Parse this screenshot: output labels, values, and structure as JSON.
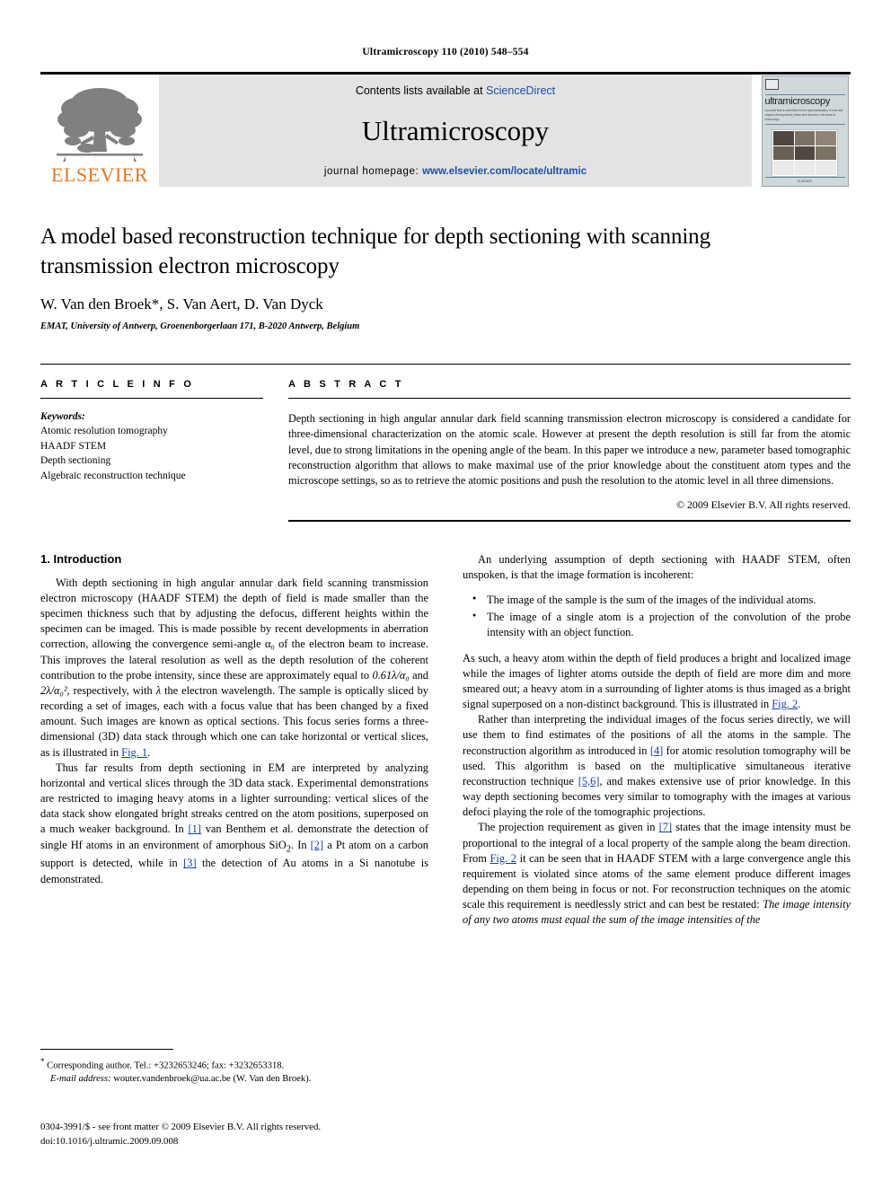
{
  "running_head": "Ultramicroscopy 110 (2010) 548–554",
  "masthead": {
    "publisher_name": "ELSEVIER",
    "contents_prefix": "Contents lists available at",
    "contents_link": "ScienceDirect",
    "journal_title": "Ultramicroscopy",
    "homepage_prefix": "journal homepage:",
    "homepage_link": "www.elsevier.com/locate/ultramic",
    "cover": {
      "name": "ultramicroscopy",
      "tagline": "A journal that is committed to the rapid publication of new and original developments, ideas and theories in all areas of microscopy",
      "footer": "ELSEVIER"
    },
    "link_color": "#1a4fa0",
    "brand_color": "#E87722"
  },
  "article": {
    "title": "A model based reconstruction technique for depth sectioning with scanning transmission electron microscopy",
    "authors": "W. Van den Broek*, S. Van Aert, D. Van Dyck",
    "affiliation": "EMAT, University of Antwerp, Groenenborgerlaan 171, B-2020 Antwerp, Belgium"
  },
  "article_info": {
    "label": "A R T I C L E   I N F O",
    "keywords_label": "Keywords:",
    "keywords": [
      "Atomic resolution tomography",
      "HAADF STEM",
      "Depth sectioning",
      "Algebraic reconstruction technique"
    ]
  },
  "abstract": {
    "label": "A B S T R A C T",
    "text": "Depth sectioning in high angular annular dark field scanning transmission electron microscopy is considered a candidate for three-dimensional characterization on the atomic scale. However at present the depth resolution is still far from the atomic level, due to strong limitations in the opening angle of the beam. In this paper we introduce a new, parameter based tomographic reconstruction algorithm that allows to make maximal use of the prior knowledge about the constituent atom types and the microscope settings, so as to retrieve the atomic positions and push the resolution to the atomic level in all three dimensions.",
    "copyright": "© 2009 Elsevier B.V. All rights reserved."
  },
  "body": {
    "section1_heading": "1.  Introduction",
    "left": {
      "p1_a": "With depth sectioning in high angular annular dark field scanning transmission electron microscopy (HAADF STEM) the depth of field is made smaller than the specimen thickness such that by adjusting the defocus, different heights within the specimen can be imaged. This is made possible by recent developments in aberration correction, allowing the convergence semi-angle ",
      "p1_alpha0": "α₀",
      "p1_b": " of the electron beam to increase. This improves the lateral resolution as well as the depth resolution of the coherent contribution to the probe intensity, since these are approximately equal to ",
      "p1_expr1": "0.61λ/α₀",
      "p1_c": " and ",
      "p1_expr2": "2λ/α₀²",
      "p1_d": ", respectively, with ",
      "p1_lambda": "λ",
      "p1_e": " the electron wavelength. The sample is optically sliced by recording a set of images, each with a focus value that has been changed by a fixed amount. Such images are known as optical sections. This focus series forms a three-dimensional (3D) data stack through which one can take horizontal or vertical slices, as is illustrated in ",
      "p1_fig1": "Fig. 1",
      "p1_f": ".",
      "p2_a": "Thus far results from depth sectioning in EM are interpreted by analyzing horizontal and vertical slices through the 3D data stack. Experimental demonstrations are restricted to imaging heavy atoms in a lighter surrounding: vertical slices of the data stack show elongated bright streaks centred on the atom positions, superposed on a much weaker background. In ",
      "p2_ref1": "[1]",
      "p2_b": " van Benthem et al. demonstrate the detection of single Hf atoms in an environment of amorphous SiO",
      "p2_sub2": "2",
      "p2_c": ". In ",
      "p2_ref2": "[2]",
      "p2_d": " a Pt atom on a carbon support is detected, while in ",
      "p2_ref3": "[3]",
      "p2_e": " the detection of Au atoms in a Si nanotube is demonstrated."
    },
    "right": {
      "p1": "An underlying assumption of depth sectioning with HAADF STEM, often unspoken, is that the image formation is incoherent:",
      "bullets": [
        "The image of the sample is the sum of the images of the individual atoms.",
        "The image of a single atom is a projection of the convolution of the probe intensity with an object function."
      ],
      "p2_a": "As such, a heavy atom within the depth of field produces a bright and localized image while the images of lighter atoms outside the depth of field are more dim and more smeared out; a heavy atom in a surrounding of lighter atoms is thus imaged as a bright signal superposed on a non-distinct background. This is illustrated in ",
      "p2_fig2": "Fig. 2",
      "p2_b": ".",
      "p3_a": "Rather than interpreting the individual images of the focus series directly, we will use them to find estimates of the positions of all the atoms in the sample. The reconstruction algorithm as introduced in ",
      "p3_ref4": "[4]",
      "p3_b": " for atomic resolution tomography will be used. This algorithm is based on the multiplicative simultaneous iterative reconstruction technique ",
      "p3_ref56": "[5,6]",
      "p3_c": ", and makes extensive use of prior knowledge. In this way depth sectioning becomes very similar to tomography with the images at various defoci playing the role of the tomographic projections.",
      "p4_a": "The projection requirement as given in ",
      "p4_ref7": "[7]",
      "p4_b": " states that the image intensity must be proportional to the integral of a local property of the sample along the beam direction. From ",
      "p4_fig2": "Fig. 2",
      "p4_c": " it can be seen that in HAADF STEM with a large convergence angle this requirement is violated since atoms of the same element produce different images depending on them being in focus or not. For reconstruction techniques on the atomic scale this requirement is needlessly strict and can best be restated: ",
      "p4_italic": "The image intensity of any two atoms must equal the sum of the image intensities of the"
    }
  },
  "footnote": {
    "corresponding": "Corresponding author. Tel.: +3232653246; fax: +3232653318.",
    "email_label": "E-mail address:",
    "email": "wouter.vandenbroek@ua.ac.be (W. Van den Broek)."
  },
  "imprint": {
    "line1": "0304-3991/$ - see front matter © 2009 Elsevier B.V. All rights reserved.",
    "line2": "doi:10.1016/j.ultramic.2009.09.008"
  }
}
